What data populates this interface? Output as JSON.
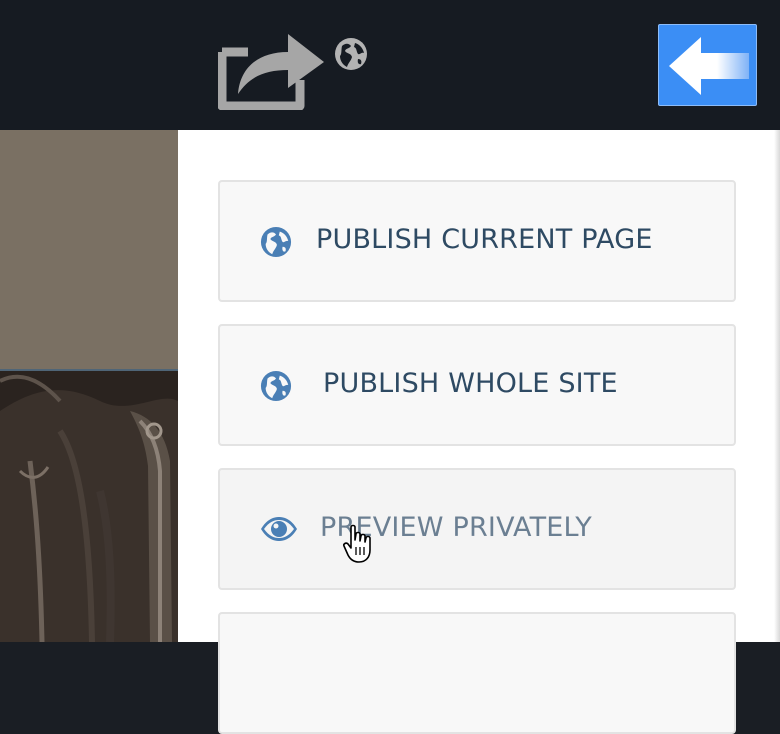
{
  "toolbar": {
    "share_icon": "share-arrow-icon",
    "globe_icon": "globe-icon",
    "back_icon": "arrow-left-icon",
    "back_button_color": "#3b8ef5"
  },
  "menu": {
    "items": [
      {
        "label": "PUBLISH CURRENT PAGE",
        "icon": "globe-icon"
      },
      {
        "label": "PUBLISH WHOLE SITE",
        "icon": "globe-icon"
      },
      {
        "label": "PREVIEW PRIVATELY",
        "icon": "eye-icon"
      }
    ]
  },
  "colors": {
    "topbar": "#161b22",
    "accent": "#3b8ef5",
    "icon_blue": "#4a7fb5",
    "label_text": "#2e4a63"
  }
}
